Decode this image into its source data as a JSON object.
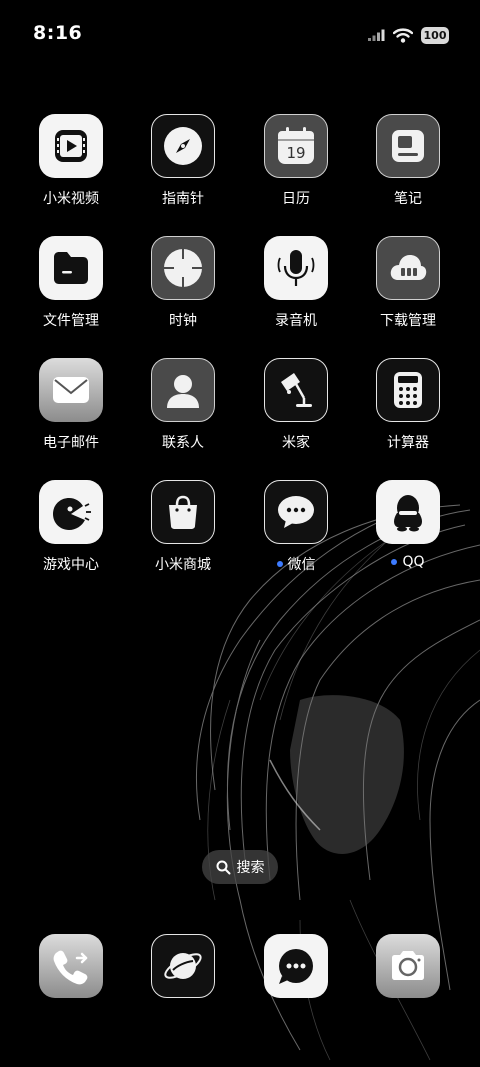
{
  "status_bar": {
    "time": "8:16",
    "battery": "100"
  },
  "apps": [
    {
      "label": "小米视频",
      "icon": "video-icon"
    },
    {
      "label": "指南针",
      "icon": "compass-icon"
    },
    {
      "label": "日历",
      "icon": "calendar-icon",
      "day": "19"
    },
    {
      "label": "笔记",
      "icon": "notes-icon"
    },
    {
      "label": "文件管理",
      "icon": "folder-icon"
    },
    {
      "label": "时钟",
      "icon": "clock-icon"
    },
    {
      "label": "录音机",
      "icon": "microphone-icon"
    },
    {
      "label": "下载管理",
      "icon": "cloud-download-icon"
    },
    {
      "label": "电子邮件",
      "icon": "mail-icon"
    },
    {
      "label": "联系人",
      "icon": "contact-icon"
    },
    {
      "label": "米家",
      "icon": "lamp-icon"
    },
    {
      "label": "计算器",
      "icon": "calculator-icon"
    },
    {
      "label": "游戏中心",
      "icon": "game-center-icon"
    },
    {
      "label": "小米商城",
      "icon": "shopping-bag-icon"
    },
    {
      "label": "微信",
      "icon": "chat-bubble-icon",
      "badge": true
    },
    {
      "label": "QQ",
      "icon": "penguin-icon",
      "badge": true
    }
  ],
  "search": {
    "label": "搜索"
  },
  "dock": [
    {
      "name": "phone",
      "icon": "phone-icon"
    },
    {
      "name": "browser",
      "icon": "planet-icon"
    },
    {
      "name": "messages",
      "icon": "message-icon"
    },
    {
      "name": "camera",
      "icon": "camera-icon"
    }
  ],
  "colors": {
    "background": "#000000",
    "badge": "#3d7bff"
  }
}
